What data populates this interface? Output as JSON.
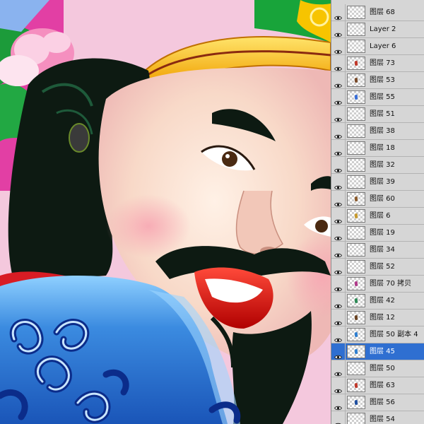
{
  "layers": [
    {
      "name": "图层 68",
      "mark": ""
    },
    {
      "name": "Layer 2",
      "mark": ""
    },
    {
      "name": "Layer 6",
      "mark": ""
    },
    {
      "name": "图层 73",
      "mark": "#c0392b"
    },
    {
      "name": "图层 53",
      "mark": "#7a4b2a"
    },
    {
      "name": "图层 55",
      "mark": "#3a6fd8"
    },
    {
      "name": "图层 51",
      "mark": ""
    },
    {
      "name": "图层 38",
      "mark": ""
    },
    {
      "name": "图层 18",
      "mark": ""
    },
    {
      "name": "图层 32",
      "mark": ""
    },
    {
      "name": "图层 39",
      "mark": ""
    },
    {
      "name": "图层 60",
      "mark": "#8b5a2b"
    },
    {
      "name": "图层 6",
      "mark": "#c79a2e"
    },
    {
      "name": "图层 19",
      "mark": ""
    },
    {
      "name": "图层 34",
      "mark": ""
    },
    {
      "name": "图层 52",
      "mark": ""
    },
    {
      "name": "图层 70 拷贝",
      "mark": "#b03a8a"
    },
    {
      "name": "图层 42",
      "mark": "#2e8b57"
    },
    {
      "name": "图层 12",
      "mark": "#6b4423"
    },
    {
      "name": "图层 50 副本 4",
      "mark": "#2f7fd0"
    },
    {
      "name": "图层 45",
      "mark": "#2f7fd0"
    },
    {
      "name": "图层 50",
      "mark": ""
    },
    {
      "name": "图层 63",
      "mark": "#c0392b"
    },
    {
      "name": "图层 56",
      "mark": "#1f4fa0"
    },
    {
      "name": "图层 54",
      "mark": ""
    }
  ],
  "selected_layer": "图层 45",
  "colors": {
    "panel_bg": "#d6d6d6",
    "selection": "#2f6fd1",
    "robe_blue": "#3b8be0",
    "hat_gold": "#f5b800",
    "lips_red": "#d41414",
    "skin": "#f6dcc8"
  },
  "icons": {
    "visibility": "eye-icon"
  }
}
